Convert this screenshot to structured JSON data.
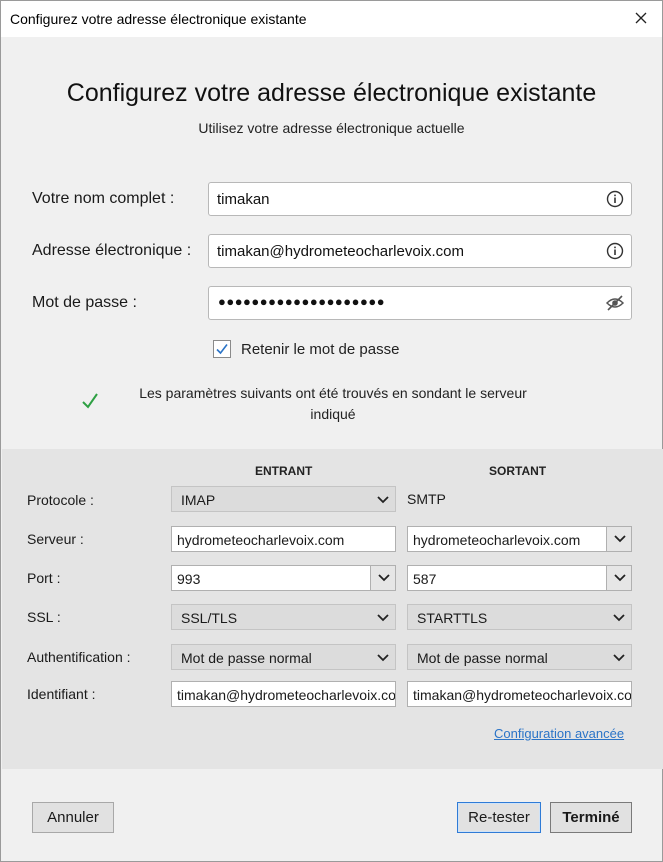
{
  "window": {
    "title": "Configurez votre adresse électronique existante",
    "close_icon": "close-icon"
  },
  "header": {
    "title": "Configurez votre adresse électronique existante",
    "subtitle": "Utilisez votre adresse électronique actuelle"
  },
  "form": {
    "name_label": "Votre nom complet :",
    "name_value": "timakan",
    "email_label": "Adresse électronique :",
    "email_value": "timakan@hydrometeocharlevoix.com",
    "password_label": "Mot de passe :",
    "password_mask": "●●●●●●●●●●●●●●●●●●●●",
    "remember_label": "Retenir le mot de passe",
    "remember_checked": true
  },
  "status": {
    "message": "Les paramètres suivants ont été trouvés en sondant le serveur indiqué",
    "icon": "checkmark-icon",
    "color": "#2ea043"
  },
  "settings": {
    "incoming_header": "ENTRANT",
    "outgoing_header": "SORTANT",
    "protocol_label": "Protocole :",
    "protocol_in": "IMAP",
    "protocol_out": "SMTP",
    "server_label": "Serveur :",
    "server_in": "hydrometeocharlevoix.com",
    "server_out": "hydrometeocharlevoix.com",
    "port_label": "Port :",
    "port_in": "993",
    "port_out": "587",
    "ssl_label": "SSL :",
    "ssl_in": "SSL/TLS",
    "ssl_out": "STARTTLS",
    "auth_label": "Authentification :",
    "auth_in": "Mot de passe normal",
    "auth_out": "Mot de passe normal",
    "username_label": "Identifiant :",
    "username_in": "timakan@hydrometeocharlevoix.com",
    "username_out": "timakan@hydrometeocharlevoix.com",
    "advanced_link": "Configuration avancée"
  },
  "buttons": {
    "cancel": "Annuler",
    "retest": "Re-tester",
    "done": "Terminé"
  },
  "colors": {
    "link": "#2b74c7",
    "focus_accent": "#2f7bd6",
    "check_accent": "#2b74c7"
  }
}
